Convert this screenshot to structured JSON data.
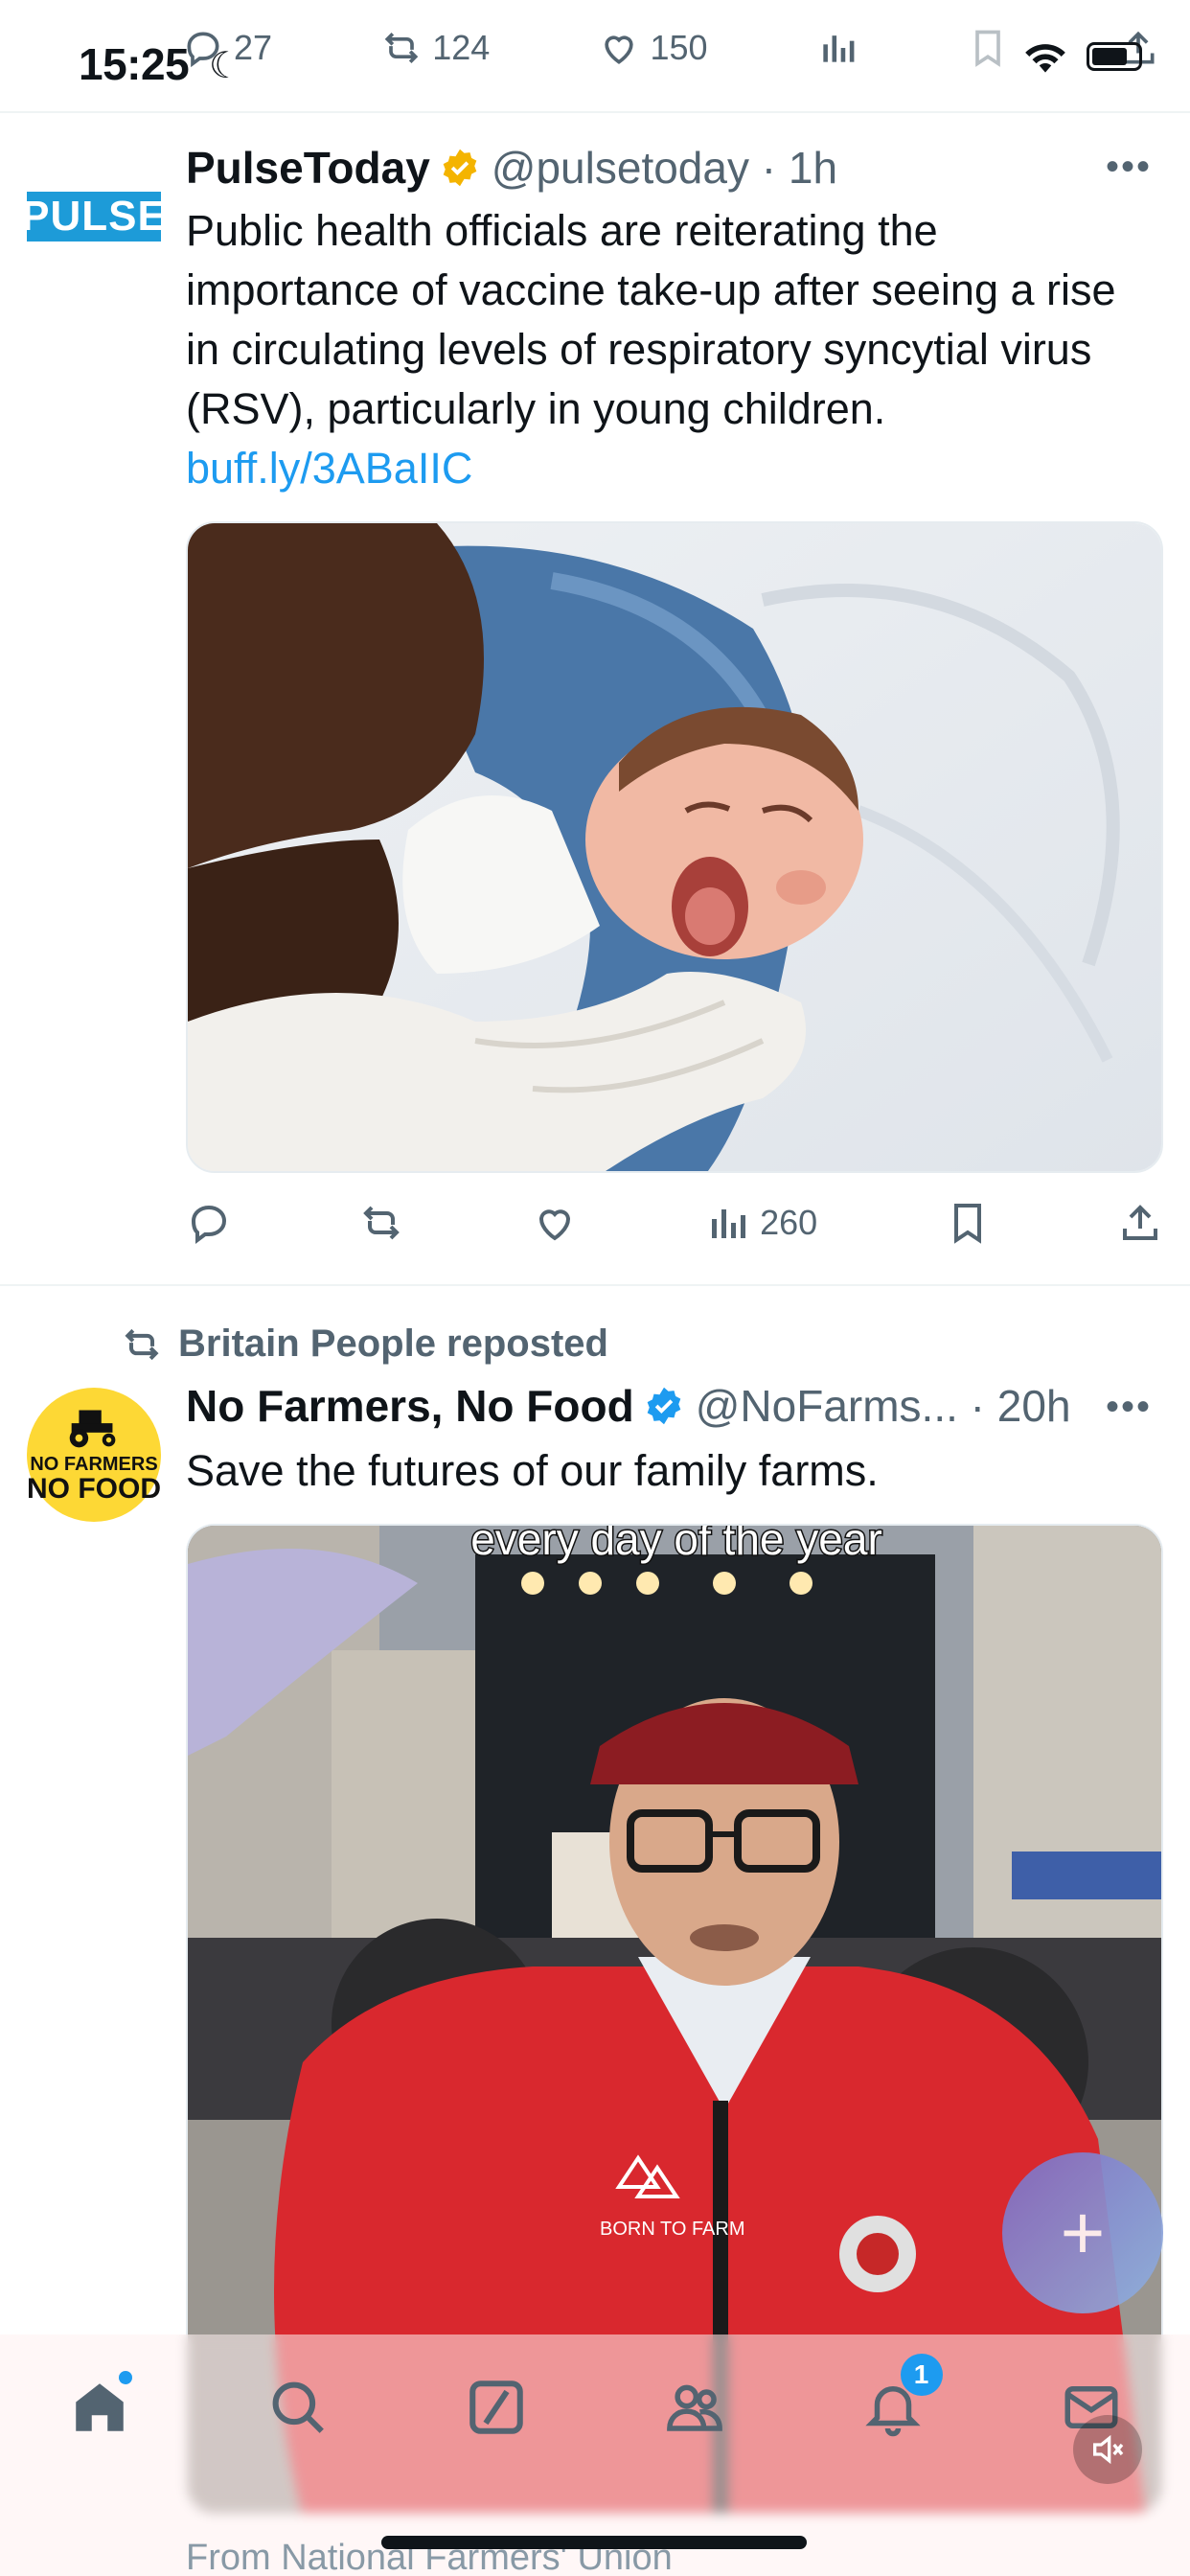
{
  "status_bar": {
    "time": "15:25"
  },
  "previous_tweet_actions": {
    "replies": "27",
    "reposts": "124",
    "likes": "150"
  },
  "tweets": [
    {
      "avatar_text": "PULSE",
      "name": "PulseToday",
      "handle": "@pulsetoday",
      "time": "1h",
      "text": "Public health officials are reiterating the importance of vaccine take-up after seeing a rise in circulating levels of respiratory syncytial virus (RSV), particularly in young children.",
      "link": "buff.ly/3ABaIIC",
      "views": "260"
    },
    {
      "reposted_by": "Britain People reposted",
      "avatar_line1": "NO FARMERS",
      "avatar_line2": "NO FOOD",
      "name": "No Farmers, No Food",
      "handle": "@NoFarms...",
      "time": "20h",
      "text": "Save the futures of our family farms.",
      "video_caption": "every day of the year",
      "jacket_text": "BORN TO FARM"
    }
  ],
  "next_preview": "From National Farmers' Union",
  "bottom_nav": {
    "notification_count": "1"
  },
  "colors": {
    "accent": "#1d9bf0",
    "text": "#0f1419",
    "muted": "#536471",
    "gold_badge": "#f4b400"
  }
}
